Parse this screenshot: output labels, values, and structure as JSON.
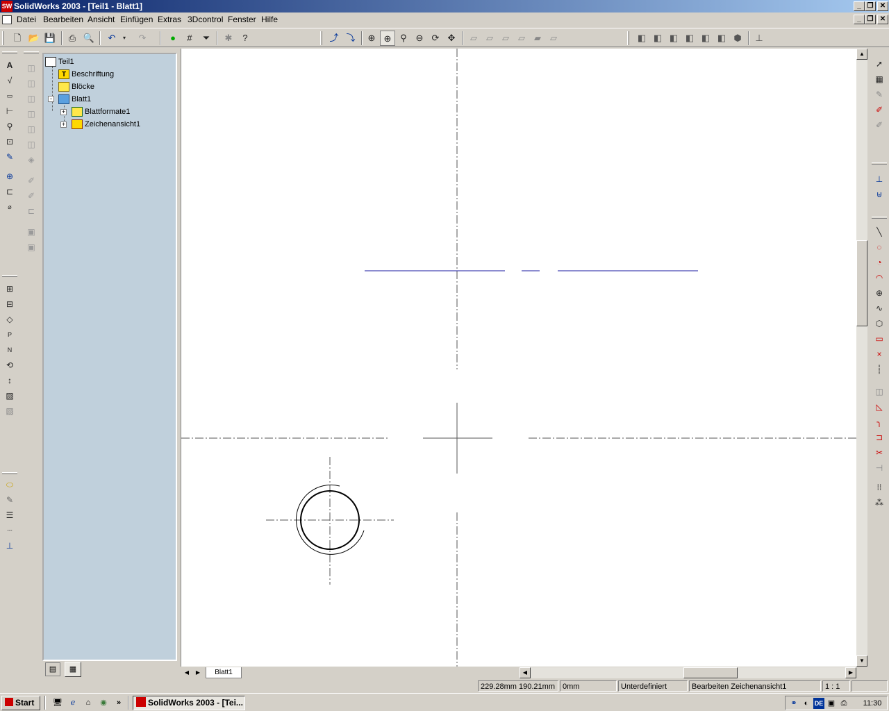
{
  "window": {
    "title": "SolidWorks 2003 - [Teil1 - Blatt1]",
    "app_icon_text": "SW"
  },
  "menu": {
    "items": [
      "Datei",
      "Bearbeiten",
      "Ansicht",
      "Einfügen",
      "Extras",
      "3Dcontrol",
      "Fenster",
      "Hilfe"
    ]
  },
  "tree": {
    "root": "Teil1",
    "items": [
      {
        "label": "Beschriftung",
        "icon": "annotation-icon"
      },
      {
        "label": "Blöcke",
        "icon": "folder-icon"
      },
      {
        "label": "Blatt1",
        "icon": "sheet-icon"
      },
      {
        "label": "Blattformate1",
        "icon": "sheet-format-icon"
      },
      {
        "label": "Zeichenansicht1",
        "icon": "drawing-view-icon"
      }
    ]
  },
  "sheet_tab": {
    "label": "Blatt1"
  },
  "status": {
    "coords": "229.28mm 190.21mm",
    "z": "0mm",
    "state": "Unterdefiniert",
    "mode": "Bearbeiten Zeichenansicht1",
    "scale": "1 : 1"
  },
  "taskbar": {
    "start_label": "Start",
    "task_label": "SolidWorks 2003 - [Tei...",
    "clock": "11:30",
    "lang": "DE"
  },
  "colors": {
    "titlebar_start": "#0a246a",
    "titlebar_end": "#a6caf0",
    "tree_bg": "#c0d0dc",
    "sketch_blue": "#1a1aa0"
  }
}
